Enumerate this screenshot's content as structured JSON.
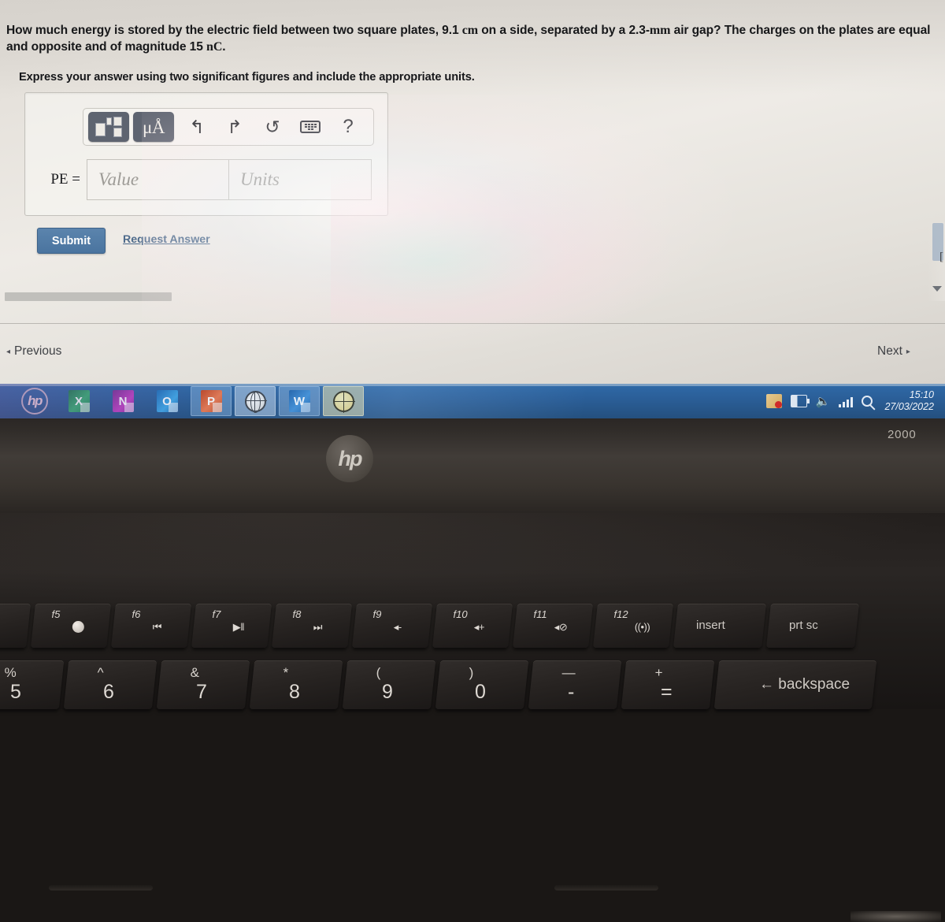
{
  "problem": {
    "question_line1": "How much energy is stored by the electric field between two square plates, 9.1",
    "unit_cm": "cm",
    "question_line1b": "on a side, separated by a 2.3-",
    "unit_mm": "mm",
    "question_line1c": "air gap? The charges on the plates are",
    "question_line2": "equal and opposite and of magnitude 15",
    "unit_nc": "nC",
    "question_line2b": ".",
    "instruction": "Express your answer using two significant figures and include the appropriate units."
  },
  "answer_widget": {
    "toolbar": {
      "template_icon": "templates-icon",
      "units_label": "μÅ",
      "undo_icon": "↰",
      "redo_icon": "↱",
      "reset_icon": "↺",
      "keyboard_icon": "keyboard-icon",
      "help_label": "?"
    },
    "variable_label": "PE =",
    "value_placeholder": "Value",
    "units_placeholder": "Units",
    "value_current": "",
    "units_current": ""
  },
  "actions": {
    "submit_label": "Submit",
    "request_answer_label": "Request Answer"
  },
  "pagination": {
    "prev_caret": "◂",
    "prev_label": "Previous",
    "next_label": "Next",
    "next_caret": "▸"
  },
  "taskbar": {
    "items": [
      {
        "name": "hp-logo",
        "label": "hp",
        "state": "idle"
      },
      {
        "name": "excel",
        "label": "X",
        "state": "idle"
      },
      {
        "name": "onenote",
        "label": "N",
        "state": "idle"
      },
      {
        "name": "outlook",
        "label": "O",
        "state": "idle"
      },
      {
        "name": "powerpoint",
        "label": "P",
        "state": "active2"
      },
      {
        "name": "internet-explorer",
        "label": "",
        "state": "active"
      },
      {
        "name": "word",
        "label": "W",
        "state": "active2"
      },
      {
        "name": "browser-amber",
        "label": "",
        "state": "active3"
      }
    ],
    "tray": {
      "antivirus": "antivirus-icon",
      "battery": "battery-icon",
      "volume": "🔈",
      "signal": "signal-bars-icon",
      "search": "search-icon"
    },
    "clock": {
      "time": "15:10",
      "date": "27/03/2022"
    }
  },
  "laptop": {
    "brand": "hp",
    "model_label": "2000",
    "fn_keys": [
      {
        "fnum": "f5",
        "icon": "spotlight"
      },
      {
        "fnum": "f6",
        "icon": "⏮"
      },
      {
        "fnum": "f7",
        "icon": "▶‖"
      },
      {
        "fnum": "f8",
        "icon": "⏭"
      },
      {
        "fnum": "f9",
        "icon": "◂-"
      },
      {
        "fnum": "f10",
        "icon": "◂+"
      },
      {
        "fnum": "f11",
        "icon": "◂⊘"
      },
      {
        "fnum": "f12",
        "icon": "((•))"
      }
    ],
    "named_keys": [
      "insert",
      "prt sc"
    ],
    "partial_key_label": "▭|",
    "num_keys": [
      {
        "sym": "%",
        "dig": "5"
      },
      {
        "sym": "^",
        "dig": "6"
      },
      {
        "sym": "&",
        "dig": "7"
      },
      {
        "sym": "*",
        "dig": "8"
      },
      {
        "sym": "(",
        "dig": "9"
      },
      {
        "sym": ")",
        "dig": "0"
      },
      {
        "sym": "—",
        "dig": "-"
      },
      {
        "sym": "+",
        "dig": "="
      }
    ],
    "backspace_label": "← backspace"
  },
  "colors": {
    "submit_blue": "#4a749f",
    "link_blue": "#4f6c8c",
    "taskbar_blue": "#2b5f99",
    "screen_bg": "#eeebe6"
  }
}
